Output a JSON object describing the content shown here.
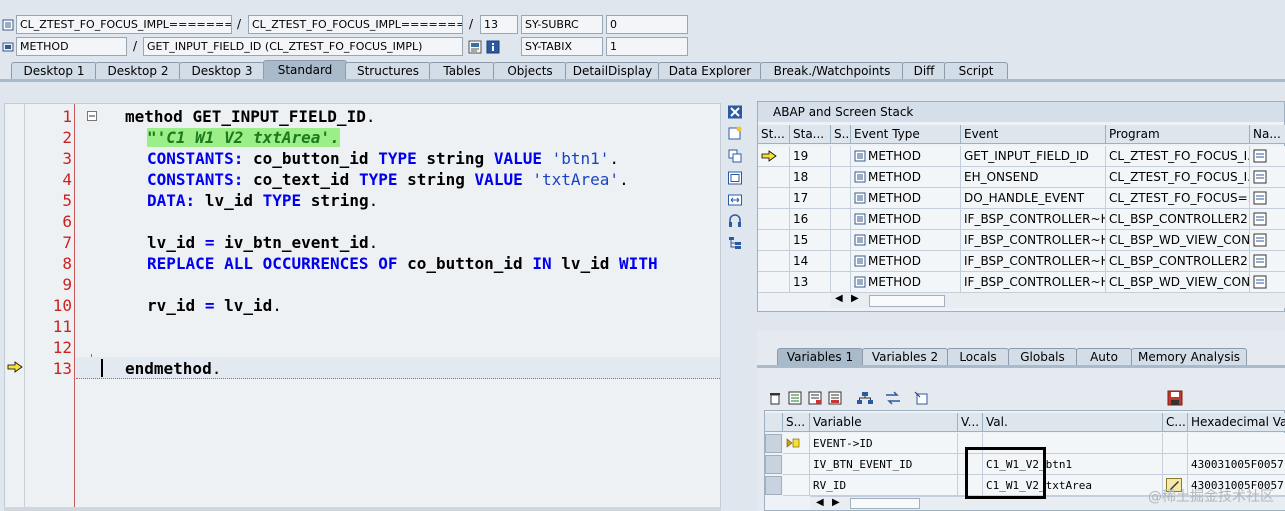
{
  "header": {
    "row1": {
      "field1": "CL_ZTEST_FO_FOCUS_IMPL=======...",
      "field2": "CL_ZTEST_FO_FOCUS_IMPL=======...",
      "line_no": "13",
      "sys_field_name": "SY-SUBRC",
      "sys_field_value": "0"
    },
    "row2": {
      "field1": "METHOD",
      "field2": "GET_INPUT_FIELD_ID (CL_ZTEST_FO_FOCUS_IMPL)",
      "sys_field_name": "SY-TABIX",
      "sys_field_value": "1"
    },
    "separator": "/"
  },
  "tabs": [
    {
      "label": "Desktop 1"
    },
    {
      "label": "Desktop 2"
    },
    {
      "label": "Desktop 3"
    },
    {
      "label": "Standard",
      "active": true
    },
    {
      "label": "Structures"
    },
    {
      "label": "Tables"
    },
    {
      "label": "Objects"
    },
    {
      "label": "DetailDisplay"
    },
    {
      "label": "Data Explorer"
    },
    {
      "label": "Break./Watchpoints"
    },
    {
      "label": "Diff"
    },
    {
      "label": "Script"
    }
  ],
  "editor": {
    "line_numbers": [
      "1",
      "2",
      "3",
      "4",
      "5",
      "6",
      "7",
      "8",
      "9",
      "10",
      "11",
      "12",
      "13"
    ],
    "lines": {
      "l1_kw": "method",
      "l1_name": "GET_INPUT_FIELD_ID",
      "l2_comment": "\"'C1 W1 V2 txtArea'.",
      "l3_kw1": "CONSTANTS:",
      "l3_name": "co_button_id",
      "l3_kw2": "TYPE",
      "l3_type": "string",
      "l3_kw3": "VALUE",
      "l3_str": "'btn1'",
      "l4_kw1": "CONSTANTS:",
      "l4_name": "co_text_id",
      "l4_kw2": "TYPE",
      "l4_type": "string",
      "l4_kw3": "VALUE",
      "l4_str": "'txtArea'",
      "l5_kw1": "DATA:",
      "l5_name": "lv_id",
      "l5_kw2": "TYPE",
      "l5_type": "string",
      "l7_lhs": "lv_id",
      "l7_eq": "=",
      "l7_rhs": "iv_btn_event_id",
      "l8_kw1": "REPLACE ALL OCCURRENCES OF",
      "l8_name": "co_button_id",
      "l8_kw2": "IN",
      "l8_var": "lv_id",
      "l8_kw3": "WITH",
      "l10_lhs": "rv_id",
      "l10_eq": "=",
      "l10_rhs": "lv_id",
      "l13_kw": "endmethod"
    },
    "dot": "."
  },
  "stack_panel": {
    "title": "ABAP and Screen Stack",
    "columns": [
      "St...",
      "Sta...",
      "S...",
      "Event Type",
      "Event",
      "Program",
      "Na..."
    ],
    "rows": [
      {
        "level": "19",
        "type": "METHOD",
        "event": "GET_INPUT_FIELD_ID",
        "program": "CL_ZTEST_FO_FOCUS_I...",
        "current": true
      },
      {
        "level": "18",
        "type": "METHOD",
        "event": "EH_ONSEND",
        "program": "CL_ZTEST_FO_FOCUS_I..."
      },
      {
        "level": "17",
        "type": "METHOD",
        "event": "DO_HANDLE_EVENT",
        "program": "CL_ZTEST_FO_FOCUS=..."
      },
      {
        "level": "16",
        "type": "METHOD",
        "event": "IF_BSP_CONTROLLER~H...",
        "program": "CL_BSP_CONTROLLER2=..."
      },
      {
        "level": "15",
        "type": "METHOD",
        "event": "IF_BSP_CONTROLLER~H...",
        "program": "CL_BSP_WD_VIEW_CON..."
      },
      {
        "level": "14",
        "type": "METHOD",
        "event": "IF_BSP_CONTROLLER~H...",
        "program": "CL_BSP_CONTROLLER2=..."
      },
      {
        "level": "13",
        "type": "METHOD",
        "event": "IF_BSP_CONTROLLER~H...",
        "program": "CL_BSP_WD_VIEW_CON..."
      }
    ]
  },
  "var_tabs": [
    {
      "label": "Variables 1",
      "active": true
    },
    {
      "label": "Variables 2"
    },
    {
      "label": "Locals"
    },
    {
      "label": "Globals"
    },
    {
      "label": "Auto"
    },
    {
      "label": "Memory Analysis"
    }
  ],
  "var_panel": {
    "columns": [
      "S...",
      "Variable",
      "V...",
      "Val.",
      "C...",
      "Hexadecimal Value"
    ],
    "rows": [
      {
        "variable": "EVENT->ID",
        "value": "",
        "hex": ""
      },
      {
        "variable": "IV_BTN_EVENT_ID",
        "value": "C1_W1_V2_btn1",
        "hex": "430031005F0057"
      },
      {
        "variable": "RV_ID",
        "value": "C1_W1_V2_txtArea",
        "hex": "430031005F0057"
      }
    ]
  },
  "watermark": "@稀土掘金技术社区",
  "colors": {
    "keyword": "#0000ee",
    "string": "#1a43c4",
    "comment_bg": "#9bee88",
    "line_number": "#cc2222",
    "tab_active": "#a9bacb"
  }
}
